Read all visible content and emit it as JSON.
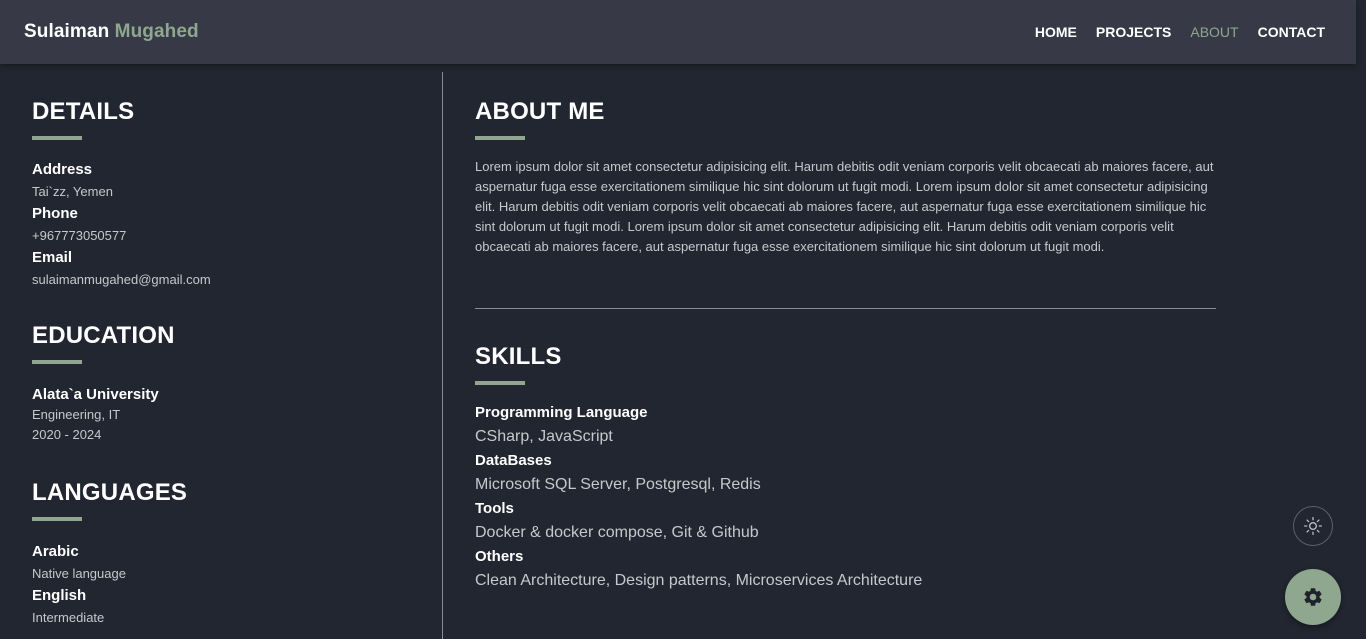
{
  "brand": {
    "first": "Sulaiman",
    "last": "Mugahed"
  },
  "nav": {
    "home": "HOME",
    "projects": "PROJECTS",
    "about": "ABOUT",
    "contact": "CONTACT"
  },
  "details": {
    "title": "DETAILS",
    "address_label": "Address",
    "address_value": "Tai`zz, Yemen",
    "phone_label": "Phone",
    "phone_value": "+967773050577",
    "email_label": "Email",
    "email_value": "sulaimanmugahed@gmail.com"
  },
  "education": {
    "title": "EDUCATION",
    "school": "Alata`a University",
    "field": "Engineering, IT",
    "years": "2020 - 2024"
  },
  "languages": {
    "title": "LANGUAGES",
    "items": [
      {
        "name": "Arabic",
        "level": "Native language"
      },
      {
        "name": "English",
        "level": "Intermediate"
      }
    ]
  },
  "about": {
    "title": "ABOUT ME",
    "text": "Lorem ipsum dolor sit amet consectetur adipisicing elit. Harum debitis odit veniam corporis velit obcaecati ab maiores facere, aut aspernatur fuga esse exercitationem similique hic sint dolorum ut fugit modi. Lorem ipsum dolor sit amet consectetur adipisicing elit. Harum debitis odit veniam corporis velit obcaecati ab maiores facere, aut aspernatur fuga esse exercitationem similique hic sint dolorum ut fugit modi. Lorem ipsum dolor sit amet consectetur adipisicing elit. Harum debitis odit veniam corporis velit obcaecati ab maiores facere, aut aspernatur fuga esse exercitationem similique hic sint dolorum ut fugit modi."
  },
  "skills": {
    "title": "SKILLS",
    "items": [
      {
        "label": "Programming Language",
        "value": "CSharp, JavaScript"
      },
      {
        "label": "DataBases",
        "value": "Microsoft SQL Server, Postgresql, Redis"
      },
      {
        "label": "Tools",
        "value": "Docker & docker compose, Git & Github"
      },
      {
        "label": "Others",
        "value": "Clean Architecture, Design patterns, Microservices Architecture"
      }
    ]
  },
  "icons": {
    "theme_toggle": "sun-icon",
    "settings": "gear-icon"
  },
  "colors": {
    "background": "#222630",
    "navbar": "#373a46",
    "accent": "#8fa68f",
    "text": "#ffffff",
    "muted": "#c6c8cd"
  }
}
